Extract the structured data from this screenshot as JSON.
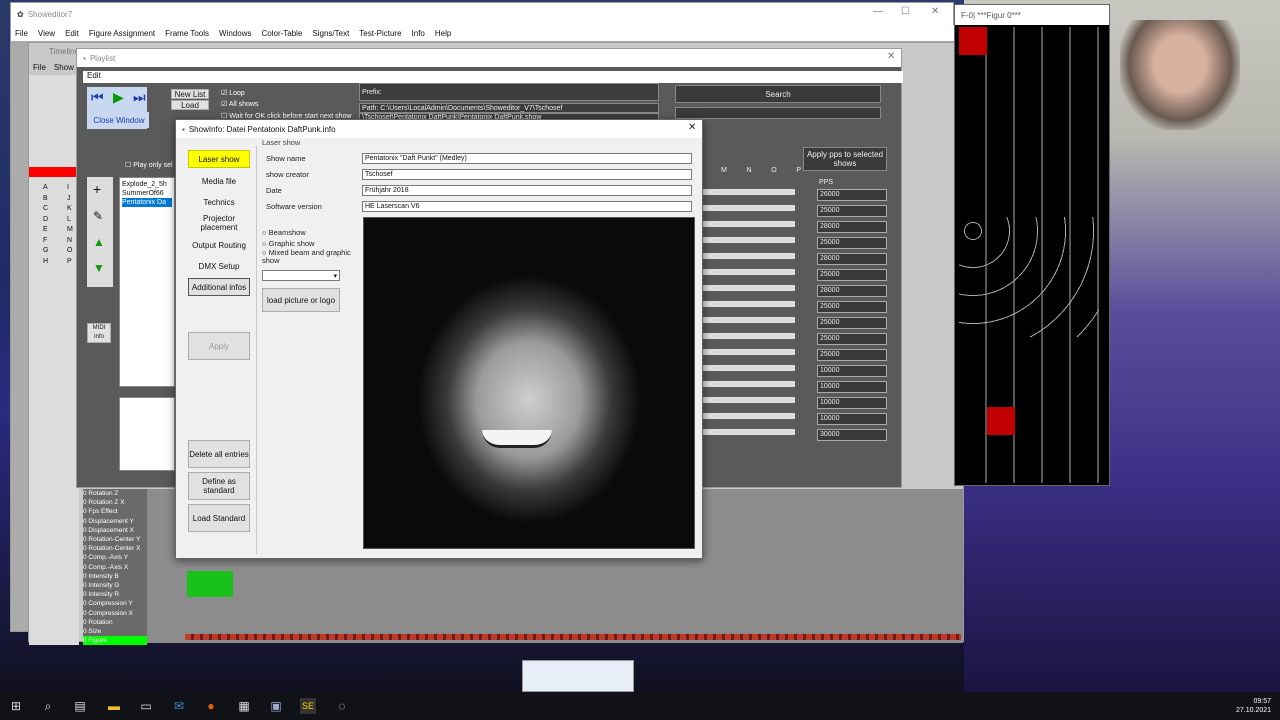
{
  "main_window": {
    "title": "Showeditor7",
    "menu": [
      "File",
      "View",
      "Edit",
      "Figure Assignment",
      "Frame Tools",
      "Windows",
      "Color-Table",
      "Signs/Text",
      "Test-Picture",
      "Info",
      "Help"
    ]
  },
  "figure_window": {
    "title": "F-0| ***Figur 0***"
  },
  "timeline": {
    "title": "Timeline",
    "menu": [
      "File",
      "Show"
    ],
    "letters": [
      "A",
      "B",
      "C",
      "D",
      "E",
      "F",
      "G",
      "H"
    ],
    "letters2": [
      "I",
      "J",
      "K",
      "L",
      "M",
      "N",
      "O",
      "P"
    ],
    "tracks": [
      "0 Rotation Z",
      "0 Rotation Z X",
      "0 Fps Effect",
      "0 Displacement Y",
      "0 Displacement X",
      "0 Rotation-Center Y",
      "0 Rotation-Center X",
      "0 Comp.-Axis Y",
      "0 Comp.-Axis X",
      "0 Intensity B",
      "0 Intensity G",
      "0 Intensity R",
      "0 Compression Y",
      "0 Compression X",
      "0 Rotation",
      "0 Size",
      "0 Figure"
    ]
  },
  "playlist": {
    "title": "Playlist",
    "menu": "Edit",
    "close_window": "Close Window",
    "new_list": "New List",
    "load": "Load",
    "loop": "Loop",
    "all_shows": "All shows",
    "wait_for_ok": "Wait for OK click before start next show",
    "play_only": "Play only sel",
    "items": [
      "Explode_2_5h",
      "SummerOf66",
      "Pentatonix Da"
    ],
    "prefix_label": "Prefix:",
    "path": "Path: C:\\Users\\LocalAdmin\\Documents\\Showeditor_V7\\Tschosef",
    "path2": "\\Tschosef\\Pentatonix DaftPunk\\Pentatonix DaftPunk.show",
    "search": "Search",
    "apply_pps": "Apply pps to selected shows",
    "cols": [
      "M",
      "N",
      "O",
      "P"
    ],
    "pps_label": "PPS",
    "pps": [
      "26000",
      "25000",
      "28000",
      "25000",
      "28000",
      "25000",
      "28000",
      "25000",
      "25000",
      "25000",
      "25000",
      "10000",
      "10000",
      "10000",
      "10000",
      "30000"
    ],
    "midi": "MIDI info"
  },
  "dialog": {
    "title": "ShowInfo: Datei Pentatonix DaftPunk.info",
    "section": "Laser show",
    "nav": [
      "Laser show",
      "Media file",
      "Technics",
      "Projector placement",
      "Output Routing",
      "DMX Setup",
      "Additional infos"
    ],
    "apply": "Apply",
    "delete_all": "Delete all entries",
    "define_standard": "Define as standard",
    "load_standard": "Load Standard",
    "fields": [
      {
        "label": "Show name",
        "value": "Pentatonix \"Daft Punkt\" (Medley)"
      },
      {
        "label": "show creator",
        "value": "Tschosef"
      },
      {
        "label": "Date",
        "value": "Frühjahr 2018"
      },
      {
        "label": "Software version",
        "value": "HE Laserscan V6"
      }
    ],
    "radios": [
      "Beamshow",
      "Graphic show",
      "Mixed beam and graphic show"
    ],
    "load_picture": "load picture or logo"
  },
  "clock": {
    "time": "09:57",
    "date": "27.10.2021"
  },
  "taskbar_icons": [
    "windows-start",
    "search",
    "task-view",
    "explorer",
    "terminal",
    "mail",
    "firefox",
    "calculator",
    "showeditor",
    "se-app",
    "app"
  ],
  "colors": {
    "accent_yellow": "#ffff00",
    "figure_green": "#00ff00",
    "red_track": "#ff0000"
  }
}
